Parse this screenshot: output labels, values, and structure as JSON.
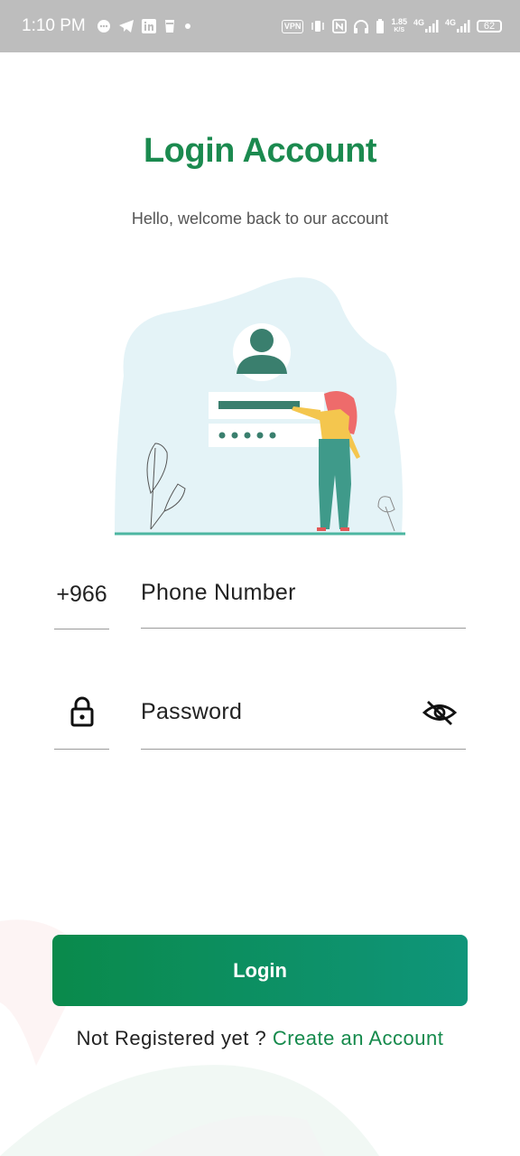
{
  "status_bar": {
    "time": "1:10 PM",
    "vpn": "VPN",
    "speed_value": "1.85",
    "speed_unit": "K/S",
    "network1": "4G",
    "network2": "4G",
    "battery": "62"
  },
  "header": {
    "title": "Login Account",
    "subtitle": "Hello, welcome back to our account"
  },
  "form": {
    "country_code": "+966",
    "phone_placeholder": "Phone Number",
    "password_placeholder": "Password"
  },
  "login_button": {
    "label": "Login"
  },
  "register": {
    "prompt": "Not Registered yet ?",
    "link": "Create an Account"
  },
  "colors": {
    "brand_green": "#1b8a4f",
    "button_start": "#0a8a4b",
    "button_end": "#0f957a",
    "status_bar": "#bdbdbd"
  }
}
